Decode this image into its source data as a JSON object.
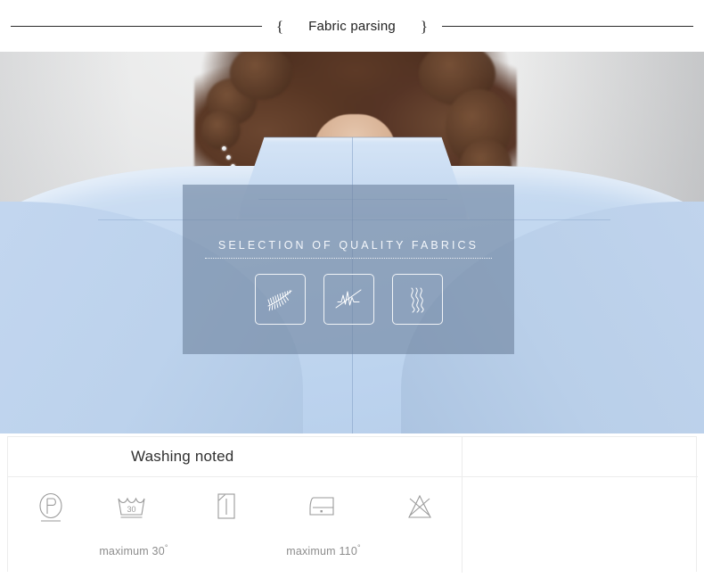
{
  "header": {
    "brace_open": "{",
    "title": "Fabric parsing",
    "brace_close": "}"
  },
  "hero": {
    "overlay": {
      "title": "SELECTION OF  QUALITY FABRICS",
      "icons": [
        {
          "name": "feather-leaf-icon",
          "label": "feather"
        },
        {
          "name": "needle-thread-icon",
          "label": "stitch"
        },
        {
          "name": "wavy-lines-icon",
          "label": "drape"
        }
      ]
    },
    "alt": "Back view of light blue stand-collar jacket"
  },
  "care": {
    "title": "Washing noted",
    "symbols": [
      {
        "icon": "dry-clean-p-icon",
        "caption": ""
      },
      {
        "icon": "wash-tub-30-icon",
        "caption": "maximum  30"
      },
      {
        "icon": "line-dry-icon",
        "caption": ""
      },
      {
        "icon": "iron-one-dot-icon",
        "caption": "maximum 110"
      },
      {
        "icon": "do-not-bleach-icon",
        "caption": ""
      }
    ],
    "degree_symbol": "°",
    "temperatures": {
      "wash": "30",
      "iron": "110"
    }
  },
  "colors": {
    "garment": "#c3d8f0",
    "overlay_panel": "#6e829e",
    "rule": "#2b2b2b",
    "border": "#ececec",
    "caption_text": "#8d8d8d"
  }
}
